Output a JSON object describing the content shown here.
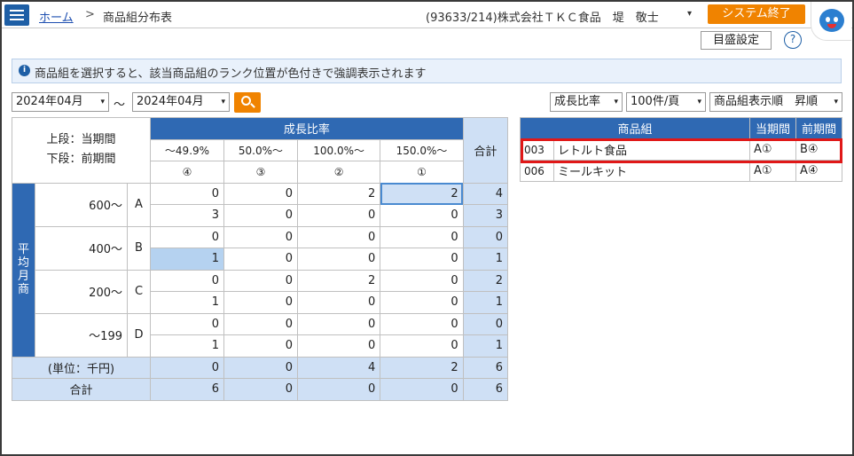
{
  "header": {
    "breadcrumb_home": "ホーム",
    "breadcrumb_sep": ">",
    "page_title": "商品組分布表",
    "user_info": "(93633/214)株式会社ＴＫＣ食品　堤　敬士",
    "user_caret": "▾",
    "exit_label": "システム終了"
  },
  "toolbar": {
    "scale_label": "目盛設定",
    "help_glyph": "?"
  },
  "info": {
    "glyph": "i",
    "message": "商品組を選択すると、該当商品組のランク位置が色付きで強調表示されます"
  },
  "filters": {
    "from_month": "2024年04月",
    "tilde": "～",
    "to_month": "2024年04月",
    "caret": "▾",
    "sort_metric": "成長比率",
    "per_page": "100件/頁",
    "display_order": "商品組表示順　昇順"
  },
  "grid": {
    "corner_top": "上段：当期間",
    "corner_bottom": "下段：前期間",
    "growth_header": "成長比率",
    "total_header": "合計",
    "columns": [
      {
        "range": "～49.9%",
        "rank": "④"
      },
      {
        "range": "50.0%～",
        "rank": "③"
      },
      {
        "range": "100.0%～",
        "rank": "②"
      },
      {
        "range": "150.0%～",
        "rank": "①"
      }
    ],
    "vertical_label": "平均月商",
    "rows": [
      {
        "sales": "600～",
        "rank": "A",
        "current": [
          "0",
          "0",
          "2",
          "2"
        ],
        "current_total": "4",
        "prior": [
          "3",
          "0",
          "0",
          "0"
        ],
        "prior_total": "3"
      },
      {
        "sales": "400～",
        "rank": "B",
        "current": [
          "0",
          "0",
          "0",
          "0"
        ],
        "current_total": "0",
        "prior": [
          "1",
          "0",
          "0",
          "0"
        ],
        "prior_total": "1"
      },
      {
        "sales": "200～",
        "rank": "C",
        "current": [
          "0",
          "0",
          "2",
          "0"
        ],
        "current_total": "2",
        "prior": [
          "1",
          "0",
          "0",
          "0"
        ],
        "prior_total": "1"
      },
      {
        "sales": "～199",
        "rank": "D",
        "current": [
          "0",
          "0",
          "0",
          "0"
        ],
        "current_total": "0",
        "prior": [
          "1",
          "0",
          "0",
          "0"
        ],
        "prior_total": "1"
      }
    ],
    "footer_unit": "(単位：千円)",
    "footer_total": "合計",
    "footer_current": [
      "0",
      "0",
      "4",
      "2"
    ],
    "footer_current_total": "6",
    "footer_prior": [
      "6",
      "0",
      "0",
      "0"
    ],
    "footer_prior_total": "6"
  },
  "list": {
    "headers": [
      "商品組",
      "当期間",
      "前期間"
    ],
    "items": [
      {
        "code": "003",
        "name": "レトルト食品",
        "current": "A①",
        "prior": "B④"
      },
      {
        "code": "006",
        "name": "ミールキット",
        "current": "A①",
        "prior": "A④"
      }
    ]
  },
  "colors": {
    "accent_blue": "#2f69b3",
    "light_blue": "#cfe0f5",
    "highlight": "#b5d2f0",
    "orange": "#f08300",
    "selection_red": "#e01818"
  }
}
